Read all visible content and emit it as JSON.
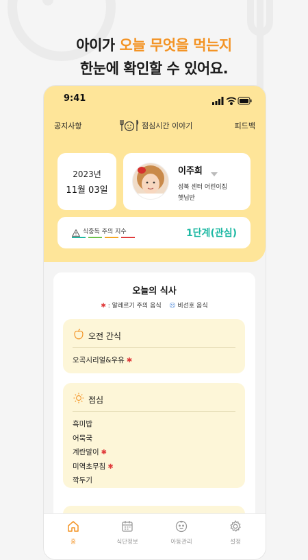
{
  "headline": {
    "line1_pre": "아이가 ",
    "line1_accent": "오늘 무엇을 먹는지",
    "line2": "한눈에 확인할 수 있어요."
  },
  "status_bar": {
    "time": "9:41"
  },
  "app_bar": {
    "left": "공지사항",
    "logo_text": "점심시간 이야기",
    "right": "피드백"
  },
  "date": {
    "year": "2023년",
    "month_day": "11월  03일"
  },
  "child": {
    "name": "이주희",
    "center": "성북 센터 어린이집",
    "class": "햇님반"
  },
  "food_poisoning_index": {
    "label": "식중독 주의 지수",
    "level": "1단계(관심)",
    "colors": [
      "#1db8a3",
      "#6cc24a",
      "#f5a623",
      "#e03c3c"
    ]
  },
  "meal": {
    "title": "오늘의 식사",
    "legend_allergy": ": 알레르기 주의 음식",
    "legend_dislike": "비선호 음식"
  },
  "snack": {
    "title": "오전 간식",
    "items": [
      {
        "name": "오곡시리얼&우유",
        "allergy": true
      }
    ]
  },
  "lunch": {
    "title": "점심",
    "items": [
      {
        "name": "흑미밥",
        "allergy": false
      },
      {
        "name": "어묵국",
        "allergy": false
      },
      {
        "name": "계란말이",
        "allergy": true
      },
      {
        "name": "미역초무침",
        "allergy": true
      },
      {
        "name": "깍두기",
        "allergy": false
      }
    ]
  },
  "tabs": [
    {
      "label": "홈",
      "icon": "home-icon",
      "active": true
    },
    {
      "label": "식단정보",
      "icon": "calendar-icon",
      "active": false
    },
    {
      "label": "아동관리",
      "icon": "child-face-icon",
      "active": false
    },
    {
      "label": "설정",
      "icon": "gear-icon",
      "active": false
    }
  ],
  "accent_color": "#f39324",
  "header_bg": "#fee599"
}
